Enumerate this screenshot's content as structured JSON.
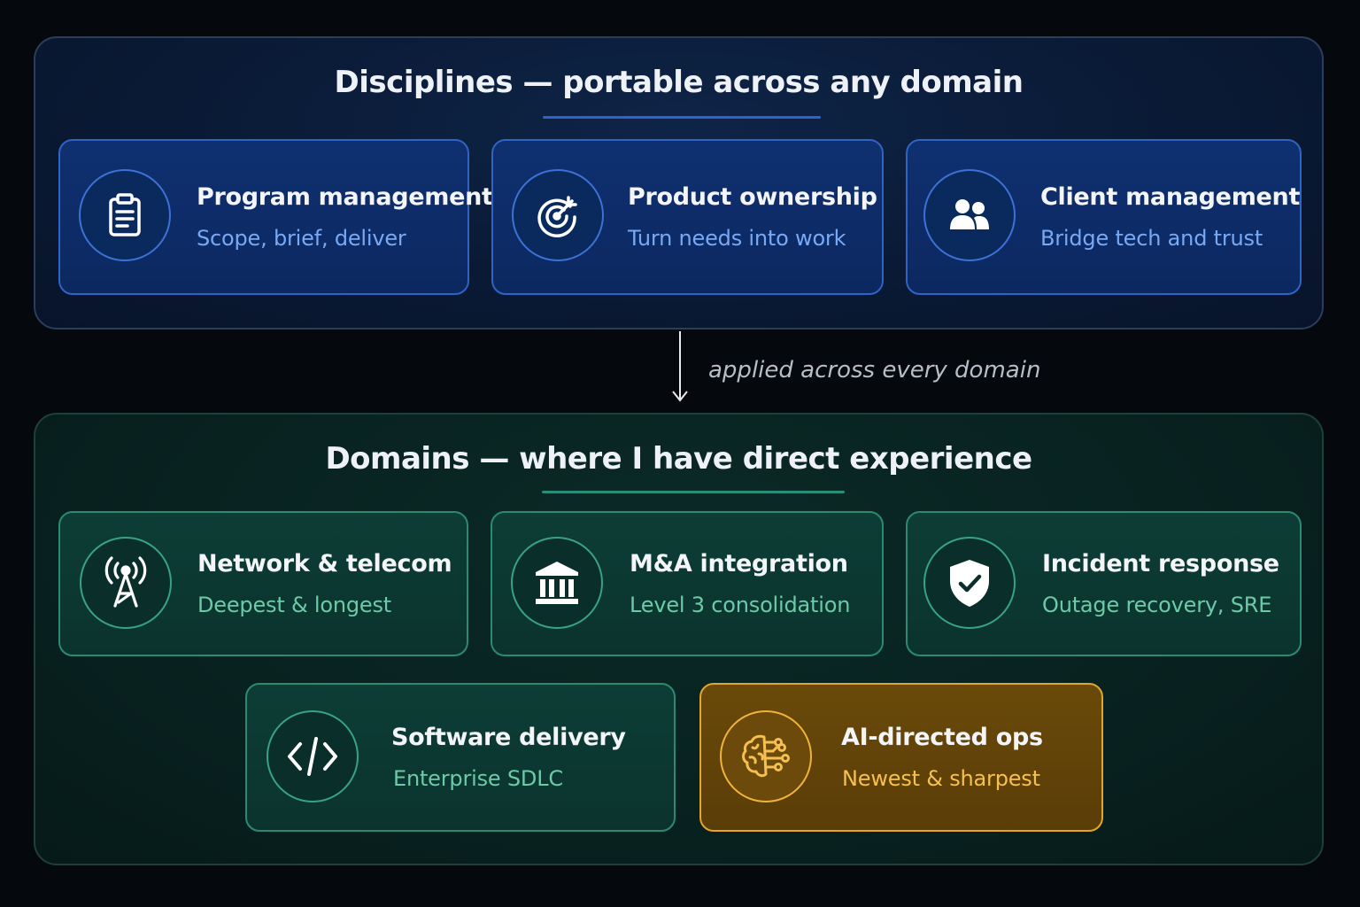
{
  "disciplines": {
    "title": "Disciplines — portable across any domain",
    "cards": [
      {
        "title": "Program management",
        "subtitle": "Scope, brief, deliver",
        "icon": "clipboard-icon"
      },
      {
        "title": "Product ownership",
        "subtitle": "Turn needs into work",
        "icon": "target-icon"
      },
      {
        "title": "Client management",
        "subtitle": "Bridge tech and trust",
        "icon": "users-icon"
      }
    ]
  },
  "connector": {
    "label": "applied across every domain"
  },
  "domains": {
    "title": "Domains — where I have direct experience",
    "cards": [
      {
        "title": "Network & telecom",
        "subtitle": "Deepest & longest",
        "icon": "antenna-icon"
      },
      {
        "title": "M&A integration",
        "subtitle": "Level 3 consolidation",
        "icon": "institution-icon"
      },
      {
        "title": "Incident response",
        "subtitle": "Outage recovery, SRE",
        "icon": "shield-check-icon"
      },
      {
        "title": "Software delivery",
        "subtitle": "Enterprise SDLC",
        "icon": "code-icon"
      },
      {
        "title": "AI-directed ops",
        "subtitle": "Newest & sharpest",
        "icon": "ai-brain-icon"
      }
    ]
  },
  "colors": {
    "discipline_accent": "#2f63c4",
    "domain_accent": "#2c8a72",
    "highlight_accent": "#e3a52b"
  }
}
